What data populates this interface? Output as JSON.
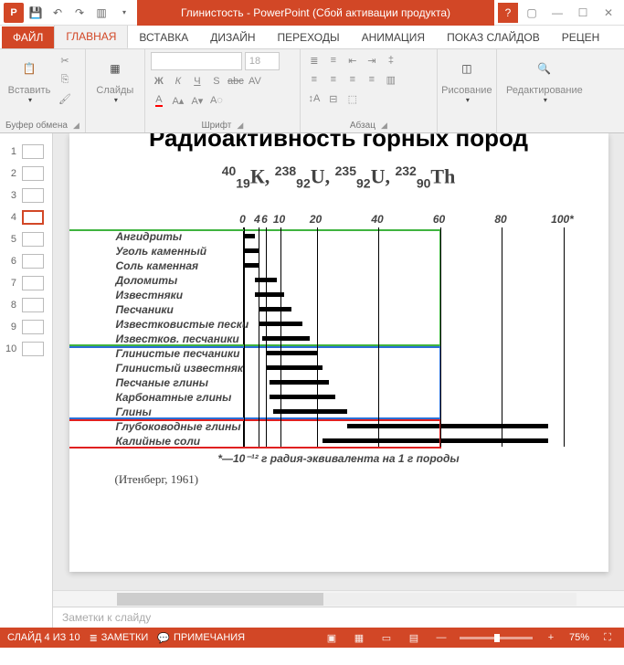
{
  "title": "Глинистость -  PowerPoint (Сбой активации продукта)",
  "tabs": [
    "ФАЙЛ",
    "ГЛАВНАЯ",
    "ВСТАВКА",
    "ДИЗАЙН",
    "ПЕРЕХОДЫ",
    "АНИМАЦИЯ",
    "ПОКАЗ СЛАЙДОВ",
    "РЕЦЕН"
  ],
  "activeTab": 1,
  "ribbon": {
    "clipboard": {
      "paste": "Вставить",
      "label": "Буфер обмена"
    },
    "slides": {
      "btn": "Слайды",
      "label": ""
    },
    "font": {
      "label": "Шрифт",
      "size": "18"
    },
    "paragraph": {
      "label": "Абзац"
    },
    "drawing": {
      "btn": "Рисование",
      "label": ""
    },
    "editing": {
      "btn": "Редактирование",
      "label": ""
    }
  },
  "thumbs": {
    "count": 10,
    "active": 4
  },
  "slide": {
    "titleCut": "Радиоактивность горных пород",
    "citation": "(Итенберг, 1961)"
  },
  "chart_data": {
    "type": "bar",
    "title": "",
    "caption": "*—10⁻¹² г радия-эквивалента на 1 г породы",
    "xticks": [
      0,
      4,
      6,
      10,
      20,
      40,
      60,
      80,
      100
    ],
    "xlim": [
      0,
      100
    ],
    "rows": [
      {
        "label": "Ангидриты",
        "from": 0,
        "to": 3
      },
      {
        "label": "Уголь каменный",
        "from": 0,
        "to": 4
      },
      {
        "label": "Соль каменная",
        "from": 0,
        "to": 4
      },
      {
        "label": "Доломиты",
        "from": 3,
        "to": 9
      },
      {
        "label": "Известняки",
        "from": 3,
        "to": 11
      },
      {
        "label": "Песчаники",
        "from": 4,
        "to": 13
      },
      {
        "label": "Известковистые пески",
        "from": 4,
        "to": 16
      },
      {
        "label": "Известков. песчаники",
        "from": 5,
        "to": 18
      },
      {
        "label": "Глинистые песчаники",
        "from": 6,
        "to": 20
      },
      {
        "label": "Глинистый известняк",
        "from": 6,
        "to": 22
      },
      {
        "label": "Песчаные глины",
        "from": 7,
        "to": 24
      },
      {
        "label": "Карбонатные глины",
        "from": 7,
        "to": 26
      },
      {
        "label": "Глины",
        "from": 8,
        "to": 30
      },
      {
        "label": "Глубоководные глины",
        "from": 30,
        "to": 95
      },
      {
        "label": "Калийные соли",
        "from": 22,
        "to": 95
      }
    ],
    "boxes": [
      {
        "color": "#3fb33f",
        "fromRow": 0,
        "toRow": 7
      },
      {
        "color": "#2a6fd6",
        "fromRow": 8,
        "toRow": 12
      },
      {
        "color": "#e02020",
        "fromRow": 13,
        "toRow": 14
      }
    ]
  },
  "notesPlaceholder": "Заметки к слайду",
  "status": {
    "slide": "СЛАЙД 4 ИЗ 10",
    "lang": "",
    "notes": "ЗАМЕТКИ",
    "comments": "ПРИМЕЧАНИЯ",
    "zoom": "75%"
  }
}
